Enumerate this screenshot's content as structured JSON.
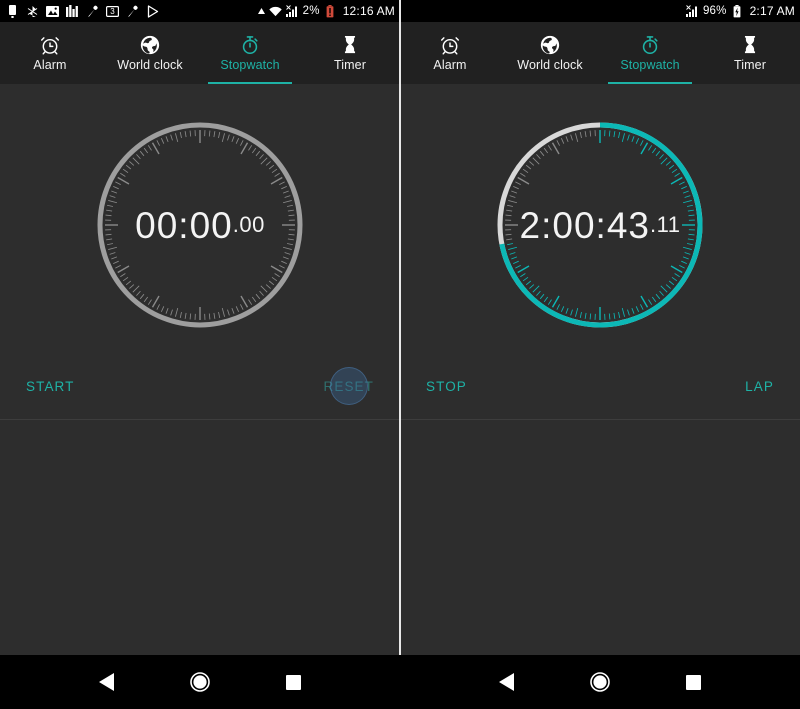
{
  "panels": [
    {
      "id": "left",
      "statusbar": {
        "left_icons": [
          "sim-card-icon",
          "bluetooth-audio-icon",
          "photo-icon",
          "equalizer-icon",
          "microphone-icon",
          "screen-record-icon",
          "microphone-icon",
          "play-store-icon"
        ],
        "right_icons": [
          "alarm-triangle-icon",
          "wifi-icon",
          "signal-bars-icon"
        ],
        "battery_percent": "2%",
        "battery_icon": "battery-low-icon",
        "time": "12:16 AM"
      },
      "tabs": [
        {
          "label": "Alarm",
          "icon": "alarm-clock-icon",
          "active": false
        },
        {
          "label": "World clock",
          "icon": "globe-icon",
          "active": false
        },
        {
          "label": "Stopwatch",
          "icon": "stopwatch-icon",
          "active": true
        },
        {
          "label": "Timer",
          "icon": "hourglass-icon",
          "active": false
        }
      ],
      "dial": {
        "time_main": "00:00",
        "time_fraction": ".00",
        "progress_degrees": 0,
        "track_color": "#9e9e9e",
        "progress_color": "#1eb2a6",
        "tick_color": "#8a8a8a"
      },
      "actions": {
        "primary_label": "START",
        "primary_enabled": true,
        "secondary_label": "RESET",
        "secondary_enabled": false,
        "secondary_ripple": true
      }
    },
    {
      "id": "right",
      "statusbar": {
        "left_icons": [],
        "right_icons": [
          "signal-bars-icon"
        ],
        "battery_percent": "96%",
        "battery_icon": "battery-charging-icon",
        "time": "2:17 AM"
      },
      "tabs": [
        {
          "label": "Alarm",
          "icon": "alarm-clock-icon",
          "active": false
        },
        {
          "label": "World clock",
          "icon": "globe-icon",
          "active": false
        },
        {
          "label": "Stopwatch",
          "icon": "stopwatch-icon",
          "active": true
        },
        {
          "label": "Timer",
          "icon": "hourglass-icon",
          "active": false
        }
      ],
      "dial": {
        "time_main": "2:00:43",
        "time_fraction": ".11",
        "progress_degrees": 259,
        "track_color": "#d8d8d8",
        "progress_color": "#0cb8b6",
        "tick_color": "#8a8a8a"
      },
      "actions": {
        "primary_label": "STOP",
        "primary_enabled": true,
        "secondary_label": "LAP",
        "secondary_enabled": true,
        "secondary_ripple": false
      }
    }
  ],
  "navbar": {
    "back_label": "back-button",
    "home_label": "home-button",
    "recents_label": "recents-button"
  },
  "theme": {
    "accent": "#1eb2a6",
    "background": "#2d2d2d",
    "tabbar_background": "#212121",
    "statusbar_background": "#000000",
    "navbar_background": "#000000"
  }
}
